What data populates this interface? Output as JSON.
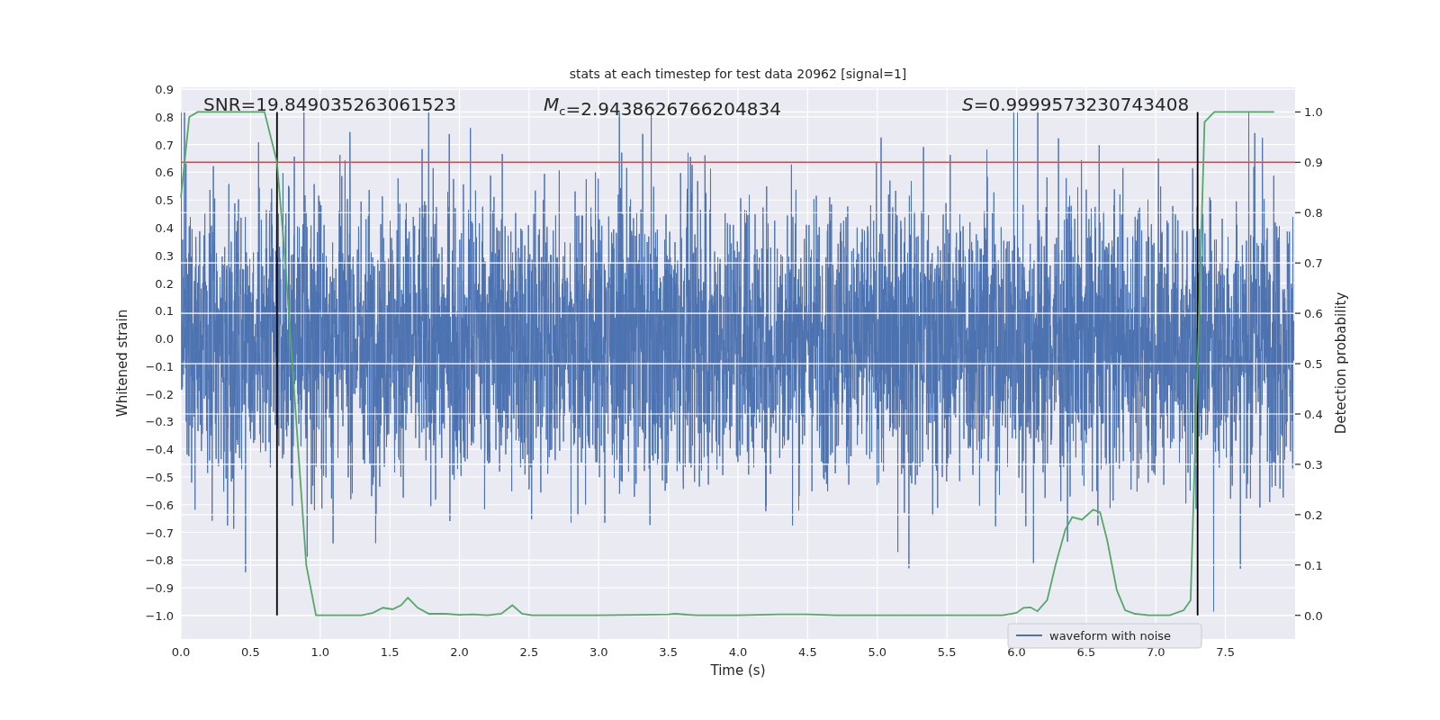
{
  "figure": {
    "chart_data": {
      "type": "line",
      "title": "stats at each timestep for test data 20962 [signal=1]",
      "xlabel": "Time (s)",
      "ylabel": "Whitened strain",
      "y2label": "Detection probability",
      "xlim": [
        0,
        8.0
      ],
      "ylim": [
        -1.085,
        0.907
      ],
      "y2lim": [
        -0.047,
        1.049
      ],
      "xticks": [
        {
          "value": 0,
          "label": "0.0"
        },
        0.5,
        {
          "value": 1,
          "label": "1.0"
        },
        1.5,
        {
          "value": 2,
          "label": "2.0"
        },
        2.5,
        {
          "value": 3,
          "label": "3.0"
        },
        3.5,
        {
          "value": 4,
          "label": "4.0"
        },
        4.5,
        {
          "value": 5,
          "label": "5.0"
        },
        5.5,
        {
          "value": 6,
          "label": "6.0"
        },
        6.5,
        {
          "value": 7,
          "label": "7.0"
        },
        7.5
      ],
      "yticks": [
        {
          "value": -1.0,
          "label": "−1.0"
        },
        {
          "value": -0.9,
          "label": "−0.9"
        },
        {
          "value": -0.8,
          "label": "−0.8"
        },
        {
          "value": -0.7,
          "label": "−0.7"
        },
        {
          "value": -0.6,
          "label": "−0.6"
        },
        {
          "value": -0.5,
          "label": "−0.5"
        },
        {
          "value": -0.4,
          "label": "−0.4"
        },
        {
          "value": -0.3,
          "label": "−0.3"
        },
        {
          "value": -0.2,
          "label": "−0.2"
        },
        {
          "value": -0.1,
          "label": "−0.1"
        },
        {
          "value": 0,
          "label": "0.0"
        },
        0.1,
        0.2,
        0.3,
        0.4,
        0.5,
        0.6,
        0.7,
        0.8,
        0.9
      ],
      "y2ticks": [
        {
          "value": 0,
          "label": "0.0"
        },
        0.1,
        0.2,
        0.3,
        0.4,
        0.5,
        0.6,
        0.7,
        0.8,
        0.9,
        {
          "value": 1,
          "label": "1.0"
        }
      ],
      "x": [
        0,
        0.06,
        0.12,
        0.6,
        0.69,
        0.75,
        0.85,
        0.9,
        0.97,
        1.3,
        1.38,
        1.45,
        1.52,
        1.58,
        1.63,
        1.7,
        1.78,
        1.9,
        2.0,
        2.1,
        2.2,
        2.3,
        2.38,
        2.45,
        2.52,
        2.6,
        3.0,
        3.3,
        3.5,
        3.55,
        3.7,
        4.0,
        4.3,
        4.5,
        4.7,
        5.0,
        5.5,
        5.9,
        6.0,
        6.05,
        6.1,
        6.15,
        6.22,
        6.28,
        6.35,
        6.4,
        6.47,
        6.55,
        6.6,
        6.65,
        6.72,
        6.78,
        6.85,
        6.95,
        7.1,
        7.2,
        7.25,
        7.3,
        7.35,
        7.42,
        7.85
      ],
      "series": [
        {
          "color": "#55a868",
          "axis": "y2",
          "values": [
            0.83,
            0.99,
            1.0,
            1.0,
            0.9,
            0.7,
            0.3,
            0.1,
            0.0,
            0.0,
            0.005,
            0.015,
            0.012,
            0.02,
            0.035,
            0.015,
            0.003,
            0.003,
            0.001,
            0.002,
            0.0,
            0.003,
            0.02,
            0.003,
            0.0,
            0.0,
            0.0,
            0.001,
            0.002,
            0.003,
            0.0,
            0.0,
            0.002,
            0.002,
            0.0,
            0.0,
            0.0,
            0.0,
            0.005,
            0.015,
            0.016,
            0.008,
            0.03,
            0.1,
            0.17,
            0.195,
            0.19,
            0.21,
            0.205,
            0.15,
            0.05,
            0.01,
            0.003,
            0.0,
            0.0,
            0.01,
            0.03,
            0.5,
            0.98,
            1.0,
            1.0
          ]
        }
      ],
      "grid": true,
      "ref_lines": [
        {
          "axis": "y2",
          "value": 0.9,
          "color": "#c44e52"
        },
        {
          "axis": "x",
          "value": 0.69,
          "color": "#000000"
        },
        {
          "axis": "x",
          "value": 7.3,
          "color": "#000000"
        }
      ],
      "annotations": [
        "SNR=19.849035263061523",
        "*M*$_{c}$=2.9438626766204834",
        "*S*=0.9999573230743408"
      ]
    },
    "legend": [
      {
        "label": "waveform with noise",
        "color": "#4c72b0"
      }
    ]
  }
}
